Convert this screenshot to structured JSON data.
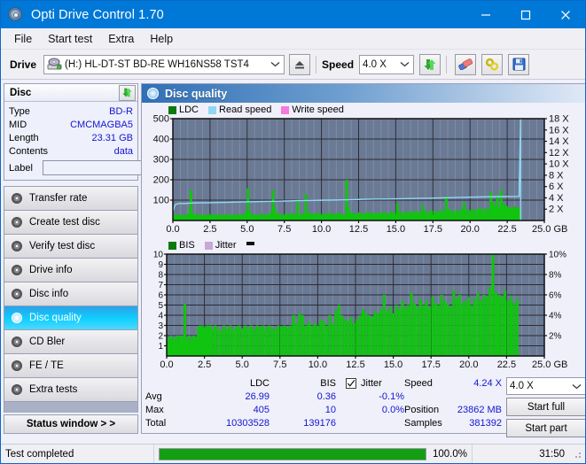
{
  "window": {
    "title": "Opti Drive Control 1.70",
    "icon": "disc-icon",
    "minimize": "minimize",
    "maximize": "maximize",
    "close": "close"
  },
  "menu": {
    "items": [
      "File",
      "Start test",
      "Extra",
      "Help"
    ]
  },
  "drivebar": {
    "drive_label": "Drive",
    "drive_value": "(H:)   HL-DT-ST BD-RE  WH16NS58 TST4",
    "eject_icon": "eject-icon",
    "speed_label": "Speed",
    "speed_value": "4.0 X",
    "refresh_icon": "refresh-icon",
    "erase_icon": "eraser-icon",
    "tools_icon": "wrench-icon",
    "save_icon": "save-icon"
  },
  "disc_panel": {
    "title": "Disc",
    "refresh_icon": "refresh-icon",
    "rows": [
      {
        "key": "Type",
        "value": "BD-R"
      },
      {
        "key": "MID",
        "value": "CMCMAGBA5"
      },
      {
        "key": "Length",
        "value": "23.31 GB"
      },
      {
        "key": "Contents",
        "value": "data"
      }
    ],
    "label_key": "Label",
    "label_value": "",
    "label_placeholder": "",
    "cd_icon": "cd-icon"
  },
  "nav": {
    "items": [
      {
        "label": "Transfer rate",
        "icon": "disc-icon",
        "selected": false
      },
      {
        "label": "Create test disc",
        "icon": "disc-icon",
        "selected": false
      },
      {
        "label": "Verify test disc",
        "icon": "disc-icon",
        "selected": false
      },
      {
        "label": "Drive info",
        "icon": "disc-icon",
        "selected": false
      },
      {
        "label": "Disc info",
        "icon": "disc-icon",
        "selected": false
      },
      {
        "label": "Disc quality",
        "icon": "disc-icon",
        "selected": true
      },
      {
        "label": "CD Bler",
        "icon": "disc-icon",
        "selected": false
      },
      {
        "label": "FE / TE",
        "icon": "disc-icon",
        "selected": false
      },
      {
        "label": "Extra tests",
        "icon": "disc-icon",
        "selected": false
      }
    ],
    "status_window": "Status window > >"
  },
  "content": {
    "title": "Disc quality",
    "icon": "disc-icon"
  },
  "stats": {
    "col_ldc": "LDC",
    "col_bis": "BIS",
    "rows": [
      {
        "key": "Avg",
        "ldc": "26.99",
        "bis": "0.36"
      },
      {
        "key": "Max",
        "ldc": "405",
        "bis": "10"
      },
      {
        "key": "Total",
        "ldc": "10303528",
        "bis": "139176"
      }
    ],
    "jitter_label": "Jitter",
    "jitter_checked": true,
    "jitter_values": [
      "-0.1%",
      "0.0%"
    ],
    "speed_label": "Speed",
    "speed_value": "4.24 X",
    "position_label": "Position",
    "position_value": "23862 MB",
    "samples_label": "Samples",
    "samples_value": "381392",
    "speed_select": "4.0 X",
    "start_full": "Start full",
    "start_part": "Start part"
  },
  "statusbar": {
    "message": "Test completed",
    "progress_text": "100.0%",
    "progress_percent": 100,
    "elapsed": "31:50"
  },
  "colors": {
    "accent": "#0078d7",
    "plot_bg": "#6b7a94",
    "ldc_green": "#10c410",
    "read_speed": "#8fd8f5",
    "write_speed": "#f57ae0",
    "jitter": "#c8a8d8",
    "value_blue": "#1515d0",
    "progress_green": "#12a012"
  },
  "chart_data": [
    {
      "type": "area",
      "name": "ldc-chart",
      "title": "LDC",
      "xlabel": "GB",
      "ylabel": "",
      "xlim": [
        0,
        25
      ],
      "xticks": [
        0.0,
        2.5,
        5.0,
        7.5,
        10.0,
        12.5,
        15.0,
        17.5,
        20.0,
        22.5,
        25.0
      ],
      "xticklabels": [
        "0.0",
        "2.5",
        "5.0",
        "7.5",
        "10.0",
        "12.5",
        "15.0",
        "17.5",
        "20.0",
        "22.5",
        "25.0 GB"
      ],
      "ylim": [
        0,
        500
      ],
      "yticks": [
        100,
        200,
        300,
        400,
        500
      ],
      "yticklabels": [
        "100",
        "200",
        "300",
        "400",
        "500"
      ],
      "y2lim": [
        0,
        18
      ],
      "y2ticks": [
        2,
        4,
        6,
        8,
        10,
        12,
        14,
        16,
        18
      ],
      "y2ticklabels": [
        "2 X",
        "4 X",
        "6 X",
        "8 X",
        "10 X",
        "12 X",
        "14 X",
        "16 X",
        "18 X"
      ],
      "grid": true,
      "legend": [
        "LDC",
        "Read speed",
        "Write speed"
      ],
      "legend_position": "top-left",
      "data_end_x": 23.4,
      "series": [
        {
          "name": "LDC",
          "color": "#10c410",
          "kind": "bars",
          "x": [
            0.1,
            0.25,
            0.4,
            0.55,
            0.7,
            0.85,
            1.0,
            1.15,
            1.22,
            1.35,
            1.5,
            1.65,
            1.8,
            1.95,
            2.1,
            2.25,
            2.4,
            2.55,
            2.7,
            2.85,
            3.0,
            3.2,
            3.4,
            3.6,
            3.8,
            4.0,
            4.2,
            4.4,
            4.6,
            4.8,
            4.95,
            5.05,
            5.2,
            5.4,
            5.6,
            5.8,
            6.0,
            6.2,
            6.4,
            6.6,
            6.75,
            6.85,
            7.0,
            7.2,
            7.4,
            7.6,
            7.8,
            8.0,
            8.2,
            8.4,
            8.6,
            8.8,
            8.95,
            9.1,
            9.3,
            9.5,
            9.7,
            9.9,
            10.1,
            10.3,
            10.5,
            10.7,
            10.9,
            11.1,
            11.3,
            11.5,
            11.7,
            11.8,
            11.9,
            12.1,
            12.3,
            12.5,
            12.7,
            12.9,
            13.1,
            13.3,
            13.5,
            13.7,
            13.9,
            14.1,
            14.3,
            14.5,
            14.7,
            14.9,
            15.1,
            15.2,
            15.4,
            15.6,
            15.8,
            16.0,
            16.2,
            16.4,
            16.6,
            16.8,
            17.0,
            17.2,
            17.4,
            17.6,
            17.8,
            18.0,
            18.2,
            18.4,
            18.55,
            18.7,
            18.9,
            19.1,
            19.3,
            19.5,
            19.6,
            19.8,
            20.0,
            20.2,
            20.4,
            20.6,
            20.8,
            21.0,
            21.2,
            21.4,
            21.55,
            21.7,
            21.85,
            21.95,
            22.1,
            22.25,
            22.4,
            22.55,
            22.7,
            22.85,
            22.95,
            23.05,
            23.15,
            23.25,
            23.35
          ],
          "y": [
            28,
            22,
            30,
            20,
            26,
            24,
            32,
            60,
            150,
            40,
            26,
            22,
            30,
            24,
            28,
            26,
            34,
            22,
            28,
            24,
            30,
            26,
            22,
            30,
            26,
            24,
            28,
            30,
            26,
            34,
            40,
            158,
            46,
            28,
            30,
            26,
            34,
            28,
            30,
            44,
            150,
            62,
            38,
            30,
            26,
            36,
            28,
            40,
            30,
            95,
            34,
            30,
            128,
            44,
            36,
            30,
            40,
            32,
            35,
            30,
            42,
            34,
            30,
            38,
            34,
            30,
            200,
            70,
            44,
            38,
            32,
            40,
            36,
            32,
            44,
            38,
            34,
            40,
            36,
            42,
            38,
            34,
            44,
            40,
            84,
            46,
            40,
            44,
            38,
            48,
            42,
            46,
            40,
            75,
            48,
            44,
            50,
            46,
            42,
            54,
            48,
            120,
            58,
            50,
            46,
            52,
            48,
            60,
            90,
            54,
            50,
            56,
            52,
            62,
            58,
            54,
            60,
            140,
            92,
            70,
            125,
            66,
            150,
            82,
            74,
            68,
            60,
            64,
            58,
            70,
            62,
            58,
            60
          ]
        },
        {
          "name": "Read speed",
          "color": "#8fd8f5",
          "kind": "line",
          "axis": "right",
          "x": [
            0.0,
            0.15,
            0.4,
            0.8,
            1.4,
            2.4,
            3.4,
            4.4,
            5.0,
            6.0,
            7.0,
            7.6,
            8.4,
            9.4,
            10.4,
            11.4,
            12.2,
            13.0,
            13.6,
            14.4,
            15.4,
            16.4,
            17.2,
            18.2,
            19.0,
            19.6,
            20.4,
            21.4,
            22.2,
            22.8,
            23.3,
            23.4,
            23.4
          ],
          "y": [
            1.6,
            2.8,
            3.0,
            3.0,
            3.1,
            3.15,
            3.2,
            3.25,
            3.3,
            3.35,
            3.4,
            3.45,
            3.5,
            3.55,
            3.6,
            3.65,
            3.7,
            3.75,
            3.78,
            3.8,
            3.85,
            3.9,
            3.95,
            4.0,
            4.05,
            4.1,
            4.15,
            4.2,
            4.22,
            4.24,
            4.24,
            18.0,
            0.0
          ]
        }
      ]
    },
    {
      "type": "area",
      "name": "bis-chart",
      "title": "BIS",
      "xlabel": "GB",
      "xlim": [
        0,
        25
      ],
      "xticks": [
        0.0,
        2.5,
        5.0,
        7.5,
        10.0,
        12.5,
        15.0,
        17.5,
        20.0,
        22.5,
        25.0
      ],
      "xticklabels": [
        "0.0",
        "2.5",
        "5.0",
        "7.5",
        "10.0",
        "12.5",
        "15.0",
        "17.5",
        "20.0",
        "22.5",
        "25.0 GB"
      ],
      "ylim": [
        0,
        10
      ],
      "yticks": [
        1,
        2,
        3,
        4,
        5,
        6,
        7,
        8,
        9,
        10
      ],
      "yticklabels": [
        "1",
        "2",
        "3",
        "4",
        "5",
        "6",
        "7",
        "8",
        "9",
        "10"
      ],
      "y2lim": [
        0,
        10
      ],
      "y2ticks": [
        2,
        4,
        6,
        8,
        10
      ],
      "y2ticklabels": [
        "2%",
        "4%",
        "6%",
        "8%",
        "10%"
      ],
      "grid": true,
      "legend": [
        "BIS",
        "Jitter"
      ],
      "legend_position": "top-left",
      "data_end_x": 23.4,
      "series": [
        {
          "name": "BIS",
          "color": "#10c410",
          "kind": "bars",
          "x": [
            0.1,
            0.2,
            0.3,
            0.4,
            0.5,
            0.6,
            0.7,
            0.8,
            0.9,
            1.0,
            1.1,
            1.2,
            1.3,
            1.4,
            1.5,
            1.6,
            1.7,
            1.8,
            1.9,
            2.0,
            2.1,
            2.2,
            2.3,
            2.4,
            2.5,
            2.6,
            2.7,
            2.8,
            2.9,
            3.0,
            3.2,
            3.4,
            3.6,
            3.8,
            4.0,
            4.2,
            4.4,
            4.6,
            4.8,
            5.0,
            5.2,
            5.4,
            5.6,
            5.8,
            6.0,
            6.2,
            6.4,
            6.6,
            6.8,
            7.0,
            7.2,
            7.4,
            7.6,
            7.8,
            8.0,
            8.2,
            8.4,
            8.6,
            8.8,
            9.0,
            9.2,
            9.4,
            9.6,
            9.8,
            10.0,
            10.2,
            10.4,
            10.6,
            10.8,
            11.0,
            11.2,
            11.4,
            11.6,
            11.8,
            12.0,
            12.2,
            12.4,
            12.6,
            12.8,
            13.0,
            13.2,
            13.4,
            13.6,
            13.8,
            14.0,
            14.2,
            14.4,
            14.6,
            14.8,
            15.0,
            15.2,
            15.4,
            15.6,
            15.8,
            16.0,
            16.2,
            16.4,
            16.6,
            16.8,
            17.0,
            17.2,
            17.4,
            17.6,
            17.8,
            18.0,
            18.2,
            18.4,
            18.6,
            18.8,
            19.0,
            19.2,
            19.4,
            19.6,
            19.8,
            20.0,
            20.2,
            20.4,
            20.6,
            20.8,
            21.0,
            21.2,
            21.4,
            21.6,
            21.8,
            21.9,
            22.0,
            22.2,
            22.4,
            22.6,
            22.8,
            23.0,
            23.2,
            23.35
          ],
          "y": [
            1.8,
            1.4,
            2.0,
            1.2,
            1.8,
            1.5,
            2.0,
            1.6,
            2.0,
            1.3,
            2.0,
            5.1,
            1.8,
            1.4,
            2.0,
            1.1,
            1.7,
            2.0,
            1.5,
            1.9,
            2.8,
            3.0,
            2.6,
            3.0,
            2.8,
            2.5,
            3.0,
            2.7,
            3.0,
            2.6,
            3.0,
            2.8,
            2.5,
            3.0,
            2.7,
            3.0,
            2.6,
            2.9,
            3.0,
            2.7,
            3.0,
            2.8,
            3.0,
            2.6,
            3.0,
            2.9,
            3.0,
            2.7,
            3.0,
            2.8,
            2.6,
            3.0,
            2.9,
            3.0,
            2.8,
            3.0,
            4.0,
            3.2,
            4.2,
            4.0,
            3.0,
            3.4,
            3.0,
            3.2,
            3.0,
            3.6,
            3.4,
            3.0,
            4.0,
            3.2,
            4.4,
            5.0,
            4.0,
            3.6,
            3.4,
            3.8,
            3.2,
            3.6,
            4.0,
            4.6,
            4.2,
            4.0,
            3.8,
            4.4,
            4.2,
            4.6,
            6.0,
            4.4,
            4.8,
            4.2,
            5.0,
            4.6,
            5.4,
            4.8,
            5.0,
            6.2,
            5.2,
            4.8,
            5.6,
            5.0,
            5.4,
            4.8,
            5.8,
            5.2,
            5.0,
            6.0,
            5.4,
            5.2,
            4.8,
            6.4,
            5.6,
            6.0,
            5.2,
            5.4,
            5.8,
            5.0,
            5.6,
            6.2,
            5.4,
            6.0,
            5.8,
            6.8,
            10.0,
            6.2,
            5.6,
            6.0,
            5.8,
            6.4,
            5.4,
            5.8,
            5.2,
            5.6
          ]
        },
        {
          "name": "Jitter",
          "color": "#c8a8d8",
          "kind": "line",
          "axis": "right",
          "x": [],
          "y": []
        }
      ]
    }
  ]
}
